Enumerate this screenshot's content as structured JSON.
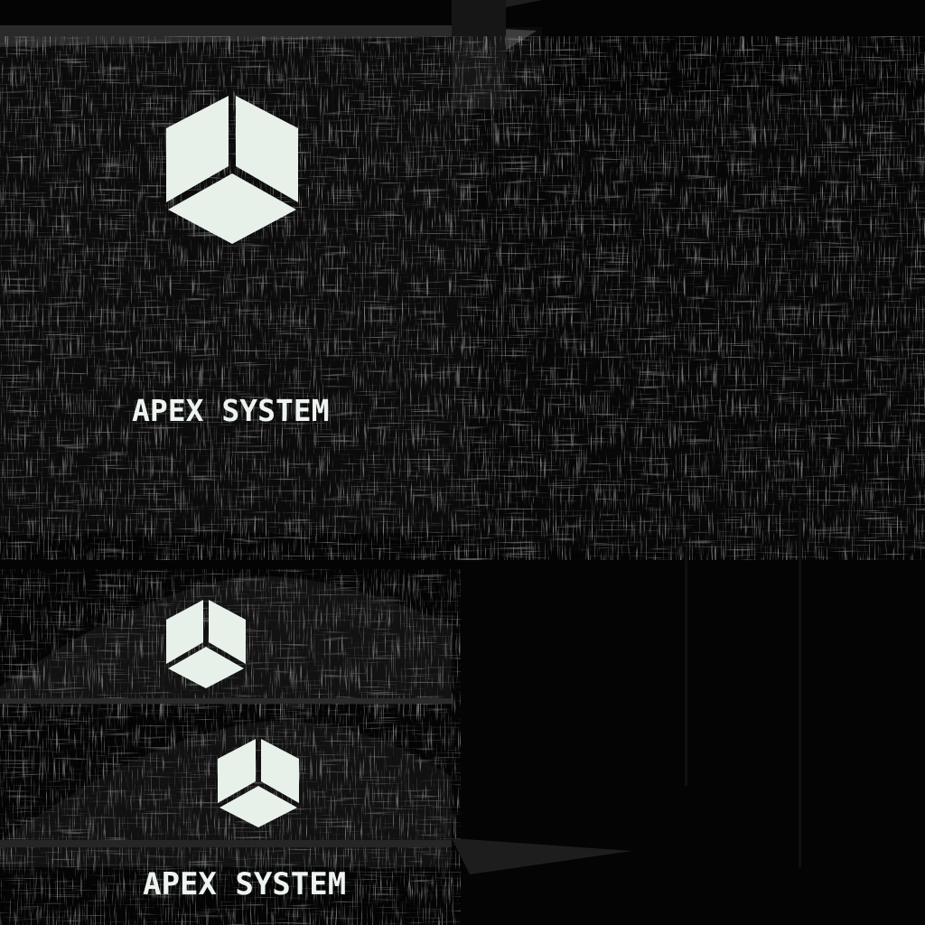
{
  "brand": {
    "name": "APEX SYSTEM",
    "name_secondary": "APEX SYSTEM"
  },
  "icons": {
    "primary_logo": "cube-logo-icon",
    "secondary_logo": "cube-logo-icon",
    "tertiary_logo": "cube-logo-icon"
  },
  "colors": {
    "background": "#040404",
    "logo_fill": "#e8f0ea",
    "grunge_light": "#3a3a3a",
    "grunge_mid": "#1c1c1c",
    "text": "#edf3ee"
  }
}
